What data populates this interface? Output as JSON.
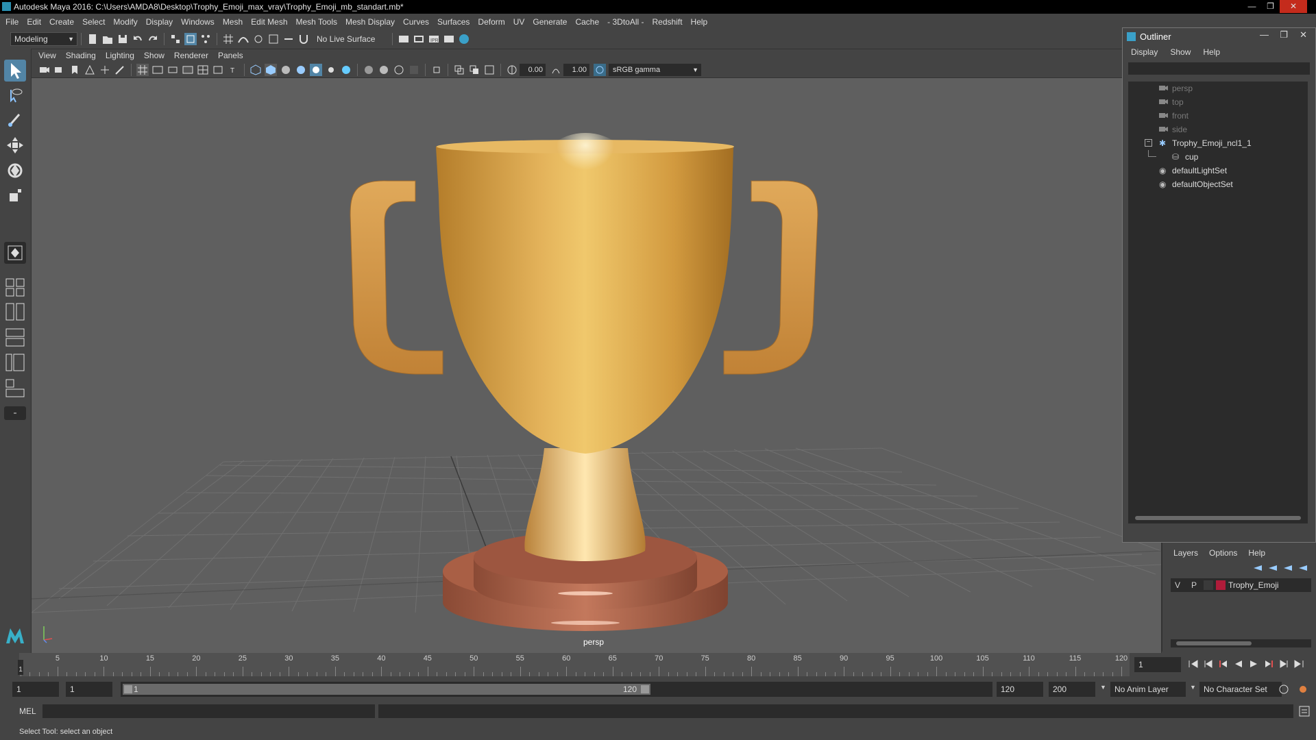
{
  "window": {
    "title": "Autodesk Maya 2016: C:\\Users\\AMDA8\\Desktop\\Trophy_Emoji_max_vray\\Trophy_Emoji_mb_standart.mb*",
    "minimize": "—",
    "restore": "❐",
    "close": "✕"
  },
  "menubar": [
    "File",
    "Edit",
    "Create",
    "Select",
    "Modify",
    "Display",
    "Windows",
    "Mesh",
    "Edit Mesh",
    "Mesh Tools",
    "Mesh Display",
    "Curves",
    "Surfaces",
    "Deform",
    "UV",
    "Generate",
    "Cache",
    "- 3DtoAll -",
    "Redshift",
    "Help"
  ],
  "statusline": {
    "mode": "Modeling",
    "live_surface": "No Live Surface"
  },
  "panel": {
    "menus": [
      "View",
      "Shading",
      "Lighting",
      "Show",
      "Renderer",
      "Panels"
    ],
    "exposure": "0.00",
    "gamma": "1.00",
    "colorspace": "sRGB gamma",
    "camera": "persp"
  },
  "outliner": {
    "title": "Outliner",
    "menus": [
      "Display",
      "Show",
      "Help"
    ],
    "items": [
      {
        "label": "persp",
        "dim": true
      },
      {
        "label": "top",
        "dim": true
      },
      {
        "label": "front",
        "dim": true
      },
      {
        "label": "side",
        "dim": true
      },
      {
        "label": "Trophy_Emoji_ncl1_1",
        "dim": false
      },
      {
        "label": "cup",
        "dim": false
      },
      {
        "label": "defaultLightSet",
        "dim": false
      },
      {
        "label": "defaultObjectSet",
        "dim": false
      }
    ]
  },
  "layers": {
    "menus": [
      "Layers",
      "Options",
      "Help"
    ],
    "row": {
      "v": "V",
      "p": "P",
      "name": "Trophy_Emoji",
      "color": "#b01c3a"
    }
  },
  "timeslider": {
    "labels": [
      "5",
      "10",
      "15",
      "20",
      "25",
      "30",
      "35",
      "40",
      "45",
      "50",
      "55",
      "60",
      "65",
      "70",
      "75",
      "80",
      "85",
      "90",
      "95",
      "100",
      "105",
      "110",
      "115",
      "120"
    ],
    "current_frame": "1",
    "frame_field": "1"
  },
  "range": {
    "start": "1",
    "playback_start": "1",
    "range_start_label": "1",
    "range_end_label": "120",
    "playback_end": "120",
    "end": "200",
    "anim_layer": "No Anim Layer",
    "character_set": "No Character Set"
  },
  "cmdline": {
    "label": "MEL"
  },
  "helpline": {
    "text": "Select Tool: select an object"
  },
  "colors": {
    "accent": "#5285a6",
    "cup": "#d9a54a",
    "base": "#a8604a"
  }
}
